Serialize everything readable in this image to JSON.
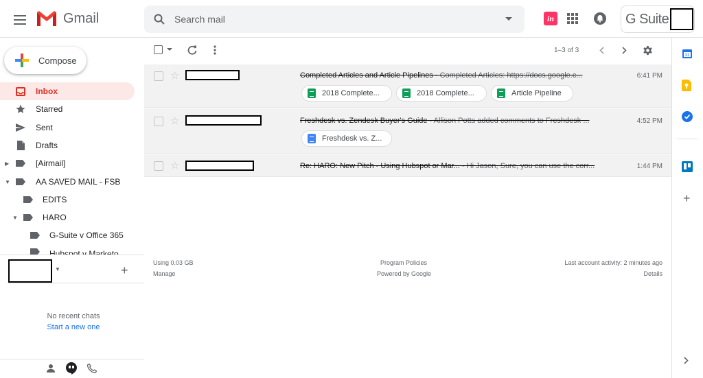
{
  "header": {
    "logo_text": "Gmail",
    "search_placeholder": "Search mail",
    "gsuite_label": "G Suite"
  },
  "sidebar": {
    "compose_label": "Compose",
    "items": [
      {
        "label": "Inbox",
        "icon": "inbox-icon"
      },
      {
        "label": "Starred",
        "icon": "star-icon"
      },
      {
        "label": "Sent",
        "icon": "send-icon"
      },
      {
        "label": "Drafts",
        "icon": "draft-icon"
      },
      {
        "label": "[Airmail]",
        "icon": "label-icon"
      },
      {
        "label": "AA SAVED MAIL - FSB",
        "icon": "label-icon"
      },
      {
        "label": "EDITS",
        "icon": "label-icon"
      },
      {
        "label": "HARO",
        "icon": "label-icon"
      },
      {
        "label": "G-Suite v Office 365",
        "icon": "label-icon"
      },
      {
        "label": "Hubspot v Marketo",
        "icon": "label-icon"
      }
    ]
  },
  "chat": {
    "no_recent": "No recent chats",
    "start_new": "Start a new one"
  },
  "toolbar": {
    "range": "1–3 of 3"
  },
  "emails": [
    {
      "subject": "Completed Articles and Article Pipelines",
      "snippet": " - Completed Articles: https://docs.google.c...",
      "time": "6:41 PM",
      "attachments": [
        {
          "name": "2018 Complete...",
          "type": "sheet"
        },
        {
          "name": "2018 Complete...",
          "type": "sheet"
        },
        {
          "name": "Article Pipeline",
          "type": "sheet"
        }
      ]
    },
    {
      "subject": "Freshdesk vs. Zendesk Buyer's Guide",
      "snippet": " - Allison Potts added comments to Freshdesk ...",
      "time": "4:52 PM",
      "attachments": [
        {
          "name": "Freshdesk vs. Z...",
          "type": "doc"
        }
      ]
    },
    {
      "subject": "Re: HARO: New Pitch - Using Hubspot or Mar...",
      "snippet": " - Hi Jason, Sure, you can use the corr...",
      "time": "1:44 PM",
      "attachments": []
    }
  ],
  "footer": {
    "storage": "Using 0.03 GB",
    "manage": "Manage",
    "policies": "Program Policies",
    "powered": "Powered by Google",
    "activity": "Last account activity: 2 minutes ago",
    "details": "Details"
  },
  "colors": {
    "accent_red": "#d93025",
    "active_bg": "#fce8e6",
    "link_blue": "#1a73e8"
  }
}
